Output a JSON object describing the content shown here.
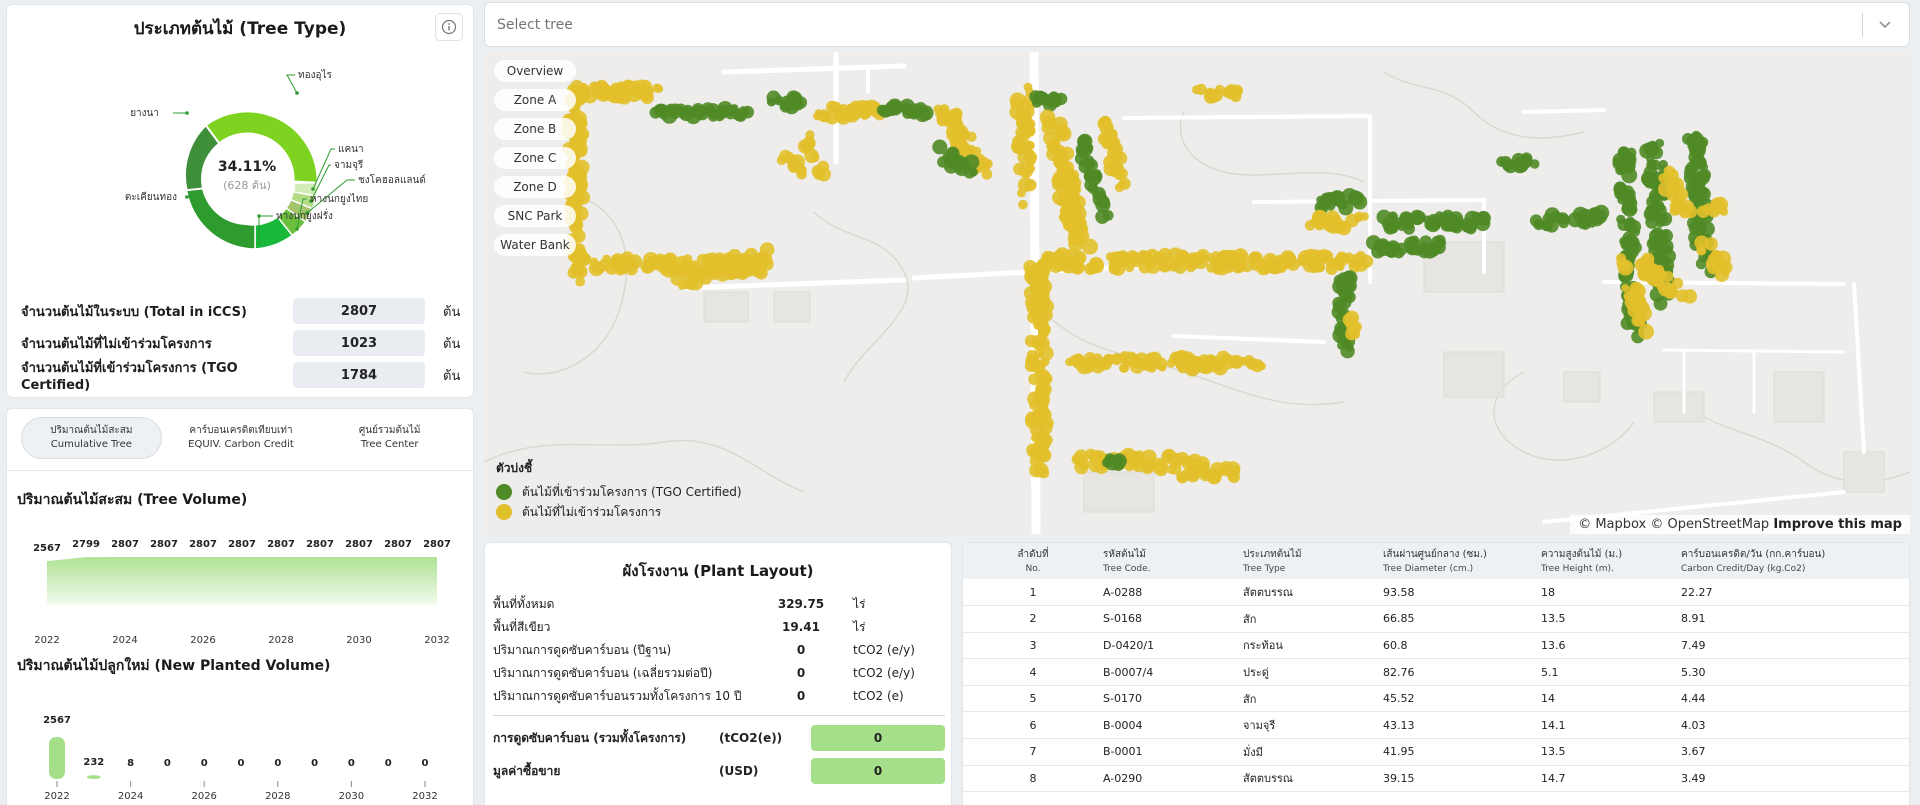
{
  "tree_type": {
    "title": "ประเภทต้นไม้ (Tree Type)",
    "info_icon": "info-icon",
    "center_percent": "34.11%",
    "center_count": "(628 ต้น)",
    "labels": {
      "thongurai": "ทองอุไร",
      "yangna": "ยางนา",
      "khaenna": "แคนา",
      "chamchuri": "จามจุรี",
      "chongkoholland": "ชงโคฮอลแลนด์",
      "hangnokyungthai": "หางนกยูงไทย",
      "takhianthong": "ตะเคียนทอง",
      "hangnokyungfarang": "หางนกยูงฝรั่ง"
    },
    "colors": {
      "thongurai": "#7ed321",
      "yangna": "#3f8f3a",
      "takhianthong": "#2e9b2e",
      "hangnokyungfarang": "#18b83a",
      "hangnokyungthai": "#6bbf3c",
      "chongkoholland": "#a3c46a",
      "chamchuri": "#b6dc8a",
      "khaenna": "#d2ecb7"
    }
  },
  "stats": [
    {
      "label": "จำนวนต้นไม้ในระบบ (Total in iCCS)",
      "value": "2807",
      "unit": "ต้น"
    },
    {
      "label": "จำนวนต้นไม้ที่ไม่เข้าร่วมโครงการ",
      "value": "1023",
      "unit": "ต้น"
    },
    {
      "label": "จำนวนต้นไม้ที่เข้าร่วมโครงการ (TGO Certified)",
      "value": "1784",
      "unit": "ต้น"
    }
  ],
  "volume_tabs": [
    {
      "th": "ปริมาณต้นไม้สะสม",
      "en": "Cumulative Tree"
    },
    {
      "th": "คาร์บอนเครดิตเทียบเท่า",
      "en": "EQUIV. Carbon Credit"
    },
    {
      "th": "ศูนย์รวมต้นไม้",
      "en": "Tree Center"
    }
  ],
  "tree_volume_title": "ปริมาณต้นไม้สะสม (Tree Volume)",
  "new_planted_title": "ปริมาณต้นไม้ปลูกใหม่ (New Planted Volume)",
  "chart_data": [
    {
      "type": "area",
      "x": [
        2022,
        2023,
        2024,
        2025,
        2026,
        2027,
        2028,
        2029,
        2030,
        2031,
        2032
      ],
      "values": [
        2567,
        2799,
        2807,
        2807,
        2807,
        2807,
        2807,
        2807,
        2807,
        2807,
        2807
      ],
      "tick_labels": [
        "2022",
        "2024",
        "2026",
        "2028",
        "2030",
        "2032"
      ],
      "color": "#a6df8a",
      "grid": false
    },
    {
      "type": "bar",
      "x": [
        2022,
        2023,
        2024,
        2025,
        2026,
        2027,
        2028,
        2029,
        2030,
        2031,
        2032
      ],
      "values": [
        2567,
        232,
        8,
        0,
        0,
        0,
        0,
        0,
        0,
        0,
        0
      ],
      "tick_labels": [
        "2022",
        "2024",
        "2026",
        "2028",
        "2030",
        "2032"
      ],
      "color": "#a6df8a",
      "grid": false
    }
  ],
  "select": {
    "placeholder": "Select tree",
    "chevron_icon": "chevron-down-icon"
  },
  "map": {
    "zones": [
      "Overview",
      "Zone A",
      "Zone B",
      "Zone C",
      "Zone D",
      "SNC Park",
      "Water Bank"
    ],
    "legend_title": "ตัวบ่งชี้",
    "legend": [
      {
        "label": "ต้นไม้ที่เข้าร่วมโครงการ (TGO Certified)",
        "color": "#4f8a26"
      },
      {
        "label": "ต้นไม้ที่ไม่เข้าร่วมโครงการ",
        "color": "#e2c02b"
      }
    ],
    "attribution": "© Mapbox © OpenStreetMap",
    "improve": "Improve this map"
  },
  "plant": {
    "title": "ผังโรงงาน (Plant Layout)",
    "rows": [
      {
        "label": "พื้นที่ทั้งหมด",
        "value": "329.75",
        "unit": "ไร่"
      },
      {
        "label": "พื้นที่สีเขียว",
        "value": "19.41",
        "unit": "ไร่"
      },
      {
        "label": "ปริมาณการดูดซับคาร์บอน (ปีฐาน)",
        "value": "0",
        "unit": "tCO2 (e/y)"
      },
      {
        "label": "ปริมาณการดูดซับคาร์บอน (เฉลี่ยรวมต่อปี)",
        "value": "0",
        "unit": "tCO2 (e/y)"
      },
      {
        "label": "ปริมาณการดูดซับคาร์บอนรวมทั้งโครงการ 10 ปี",
        "value": "0",
        "unit": "tCO2 (e)"
      }
    ],
    "totals": [
      {
        "label": "การดูดซับคาร์บอน (รวมทั้งโครงการ)",
        "unit": "(tCO2(e))",
        "value": "0"
      },
      {
        "label": "มูลค่าซื้อขาย",
        "unit": "(USD)",
        "value": "0"
      }
    ]
  },
  "table": {
    "headers": [
      {
        "th": "ลำดับที่",
        "en": "No."
      },
      {
        "th": "รหัสต้นไม้",
        "en": "Tree Code."
      },
      {
        "th": "ประเภทต้นไม้",
        "en": "Tree Type"
      },
      {
        "th": "เส้นผ่านศูนย์กลาง (ซม.)",
        "en": "Tree Diameter (cm.)"
      },
      {
        "th": "ความสูงต้นไม้ (ม.)",
        "en": "Tree Height (m)."
      },
      {
        "th": "คาร์บอนเครดิต/วัน (กก.คาร์บอน)",
        "en": "Carbon Credit/Day (kg.Co2)"
      }
    ],
    "rows": [
      [
        "1",
        "A-0288",
        "สัตตบรรณ",
        "93.58",
        "18",
        "22.27"
      ],
      [
        "2",
        "S-0168",
        "สัก",
        "66.85",
        "13.5",
        "8.91"
      ],
      [
        "3",
        "D-0420/1",
        "กระท้อน",
        "60.8",
        "13.6",
        "7.49"
      ],
      [
        "4",
        "B-0007/4",
        "ประดู่",
        "82.76",
        "5.1",
        "5.30"
      ],
      [
        "5",
        "S-0170",
        "สัก",
        "45.52",
        "14",
        "4.44"
      ],
      [
        "6",
        "B-0004",
        "จามจุรี",
        "43.13",
        "14.1",
        "4.03"
      ],
      [
        "7",
        "B-0001",
        "มั่งมี",
        "41.95",
        "13.5",
        "3.67"
      ],
      [
        "8",
        "A-0290",
        "สัตตบรรณ",
        "39.15",
        "14.7",
        "3.49"
      ]
    ]
  }
}
